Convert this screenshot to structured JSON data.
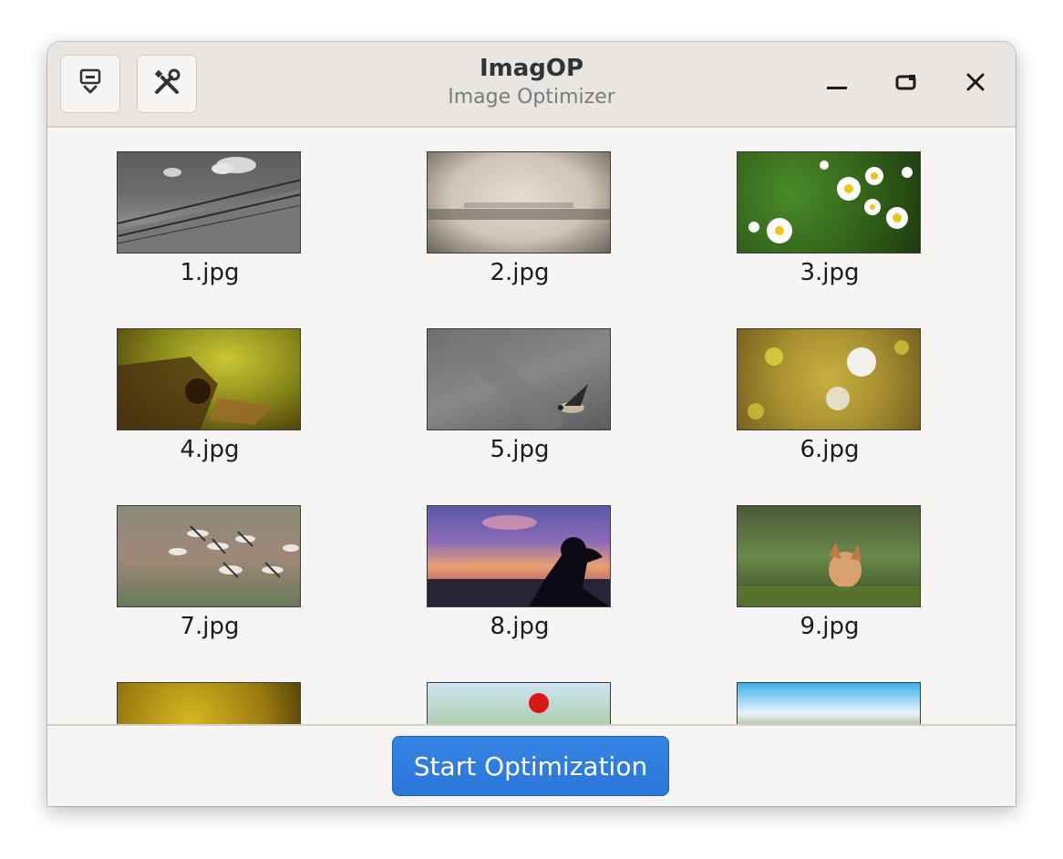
{
  "window": {
    "title": "ImagOP",
    "subtitle": "Image Optimizer"
  },
  "header_buttons": {
    "left1_icon": "import-icon",
    "left2_icon": "tools-icon",
    "minimize_icon": "minimize-icon",
    "maximize_icon": "maximize-icon",
    "close_icon": "close-icon"
  },
  "images": [
    {
      "label": "1.jpg"
    },
    {
      "label": "2.jpg"
    },
    {
      "label": "3.jpg"
    },
    {
      "label": "4.jpg"
    },
    {
      "label": "5.jpg"
    },
    {
      "label": "6.jpg"
    },
    {
      "label": "7.jpg"
    },
    {
      "label": "8.jpg"
    },
    {
      "label": "9.jpg"
    },
    {
      "label": ""
    },
    {
      "label": ""
    },
    {
      "label": ""
    }
  ],
  "footer": {
    "start_button_label": "Start Optimization"
  },
  "colors": {
    "accent": "#3584e4",
    "header_bg": "#e8e5e2",
    "window_bg": "#f6f5f4"
  }
}
